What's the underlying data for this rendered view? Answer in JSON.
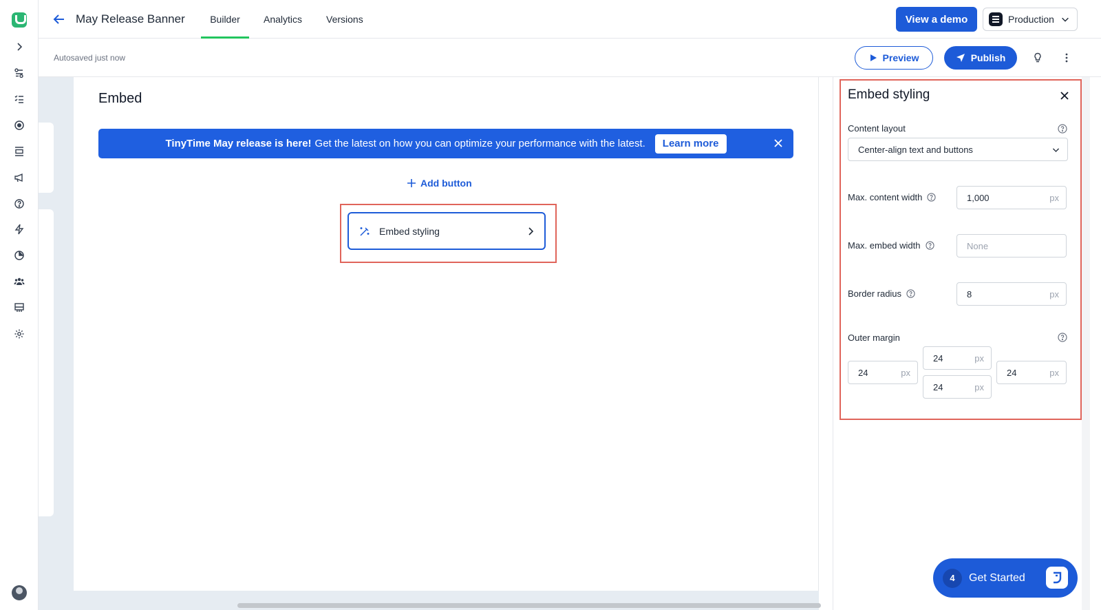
{
  "header": {
    "title": "May Release Banner",
    "tabs": [
      {
        "label": "Builder",
        "active": true
      },
      {
        "label": "Analytics",
        "active": false
      },
      {
        "label": "Versions",
        "active": false
      }
    ],
    "demo_label": "View a demo",
    "environment": "Production"
  },
  "subbar": {
    "autosave": "Autosaved just now",
    "preview_label": "Preview",
    "publish_label": "Publish"
  },
  "canvas": {
    "section_title": "Embed",
    "banner": {
      "bold_text": "TinyTime May release is here!",
      "text": "Get the latest on how you can optimize your performance with the latest.",
      "button_label": "Learn more"
    },
    "add_button_label": "Add button",
    "embed_styling_label": "Embed styling"
  },
  "panel": {
    "title": "Embed styling",
    "content_layout_label": "Content layout",
    "content_layout_value": "Center-align text and buttons",
    "max_content_width_label": "Max. content width",
    "max_content_width_value": "1,000",
    "max_embed_width_label": "Max. embed width",
    "max_embed_width_placeholder": "None",
    "border_radius_label": "Border radius",
    "border_radius_value": "8",
    "outer_margin_label": "Outer margin",
    "margin_top": "24",
    "margin_left": "24",
    "margin_right": "24",
    "margin_bottom": "24",
    "unit": "px"
  },
  "get_started": {
    "count": "4",
    "label": "Get Started"
  },
  "colors": {
    "accent": "#1d5bd8",
    "tab_indicator": "#22c55e",
    "highlight": "#e0645a"
  }
}
